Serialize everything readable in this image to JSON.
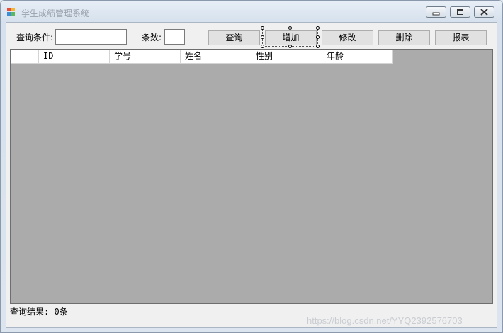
{
  "window": {
    "title": "学生成绩管理系统",
    "controls": {
      "minimize": "minimize-icon",
      "maximize": "maximize-icon",
      "close": "close-icon"
    }
  },
  "toolbar": {
    "query_condition_label": "查询条件:",
    "query_condition_value": "",
    "count_label": "条数:",
    "count_value": "",
    "buttons": {
      "query": "查询",
      "add": "增加",
      "edit": "修改",
      "delete": "删除",
      "report": "报表"
    }
  },
  "grid": {
    "columns": [
      "",
      "ID",
      "学号",
      "姓名",
      "性别",
      "年龄"
    ],
    "rows": []
  },
  "status": {
    "result_text": "查询结果: 0条"
  },
  "watermark": "https://blog.csdn.net/YYQ2392576703",
  "colors": {
    "grid_background": "#ababab",
    "client_background": "#f0f0f0",
    "button_face": "#e1e1e1"
  }
}
